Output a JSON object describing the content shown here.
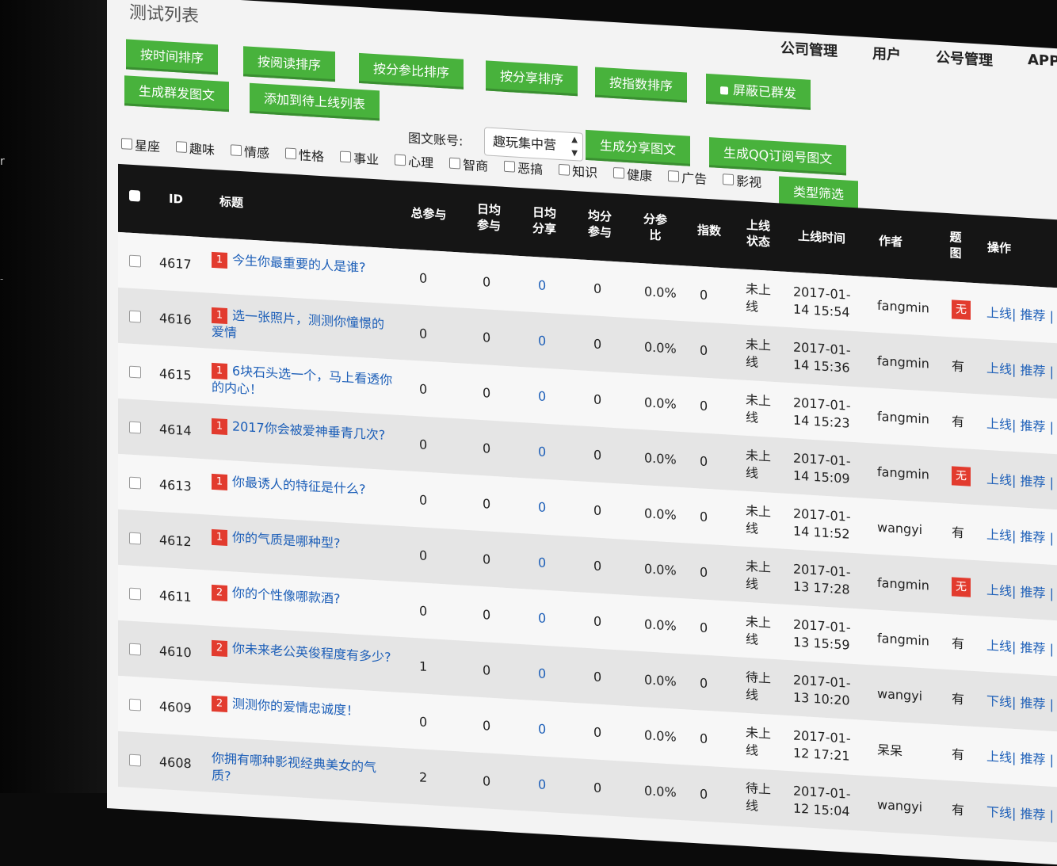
{
  "page_title": "测试列表",
  "nav": [
    "公司管理",
    "用户",
    "公号管理",
    "APP"
  ],
  "sort_buttons": [
    "按时间排序",
    "按阅读排序",
    "按分参比排序",
    "按分享排序",
    "按指数排序",
    "屏蔽已群发"
  ],
  "action_buttons": [
    "生成群发图文",
    "添加到待上线列表",
    "生成分享图文",
    "生成QQ订阅号图文"
  ],
  "account": {
    "label": "图文账号:",
    "selected": "趣玩集中营"
  },
  "filters": [
    "星座",
    "趣味",
    "情感",
    "性格",
    "事业",
    "心理",
    "智商",
    "恶搞",
    "知识",
    "健康",
    "广告",
    "影视"
  ],
  "filter_button": "类型筛选",
  "columns": [
    "ID",
    "标题",
    "总参与",
    "日均参与",
    "日均分享",
    "均分参与",
    "分参比",
    "指数",
    "上线状态",
    "上线时间",
    "作者",
    "题图",
    "操作"
  ],
  "rows": [
    {
      "id": "4617",
      "badge": "1",
      "title": "今生你最重要的人是谁?",
      "total": "0",
      "daily_join": "0",
      "daily_share": "0",
      "avg_join": "0",
      "ratio": "0.0%",
      "index": "0",
      "status": "未上线",
      "time": "2017-01-14 15:54",
      "author": "fangmin",
      "cover": "无",
      "ops": "上线| 推荐 |"
    },
    {
      "id": "4616",
      "badge": "1",
      "title": "选一张照片，测测你憧憬的爱情",
      "total": "0",
      "daily_join": "0",
      "daily_share": "0",
      "avg_join": "0",
      "ratio": "0.0%",
      "index": "0",
      "status": "未上线",
      "time": "2017-01-14 15:36",
      "author": "fangmin",
      "cover": "有",
      "ops": "上线| 推荐 |"
    },
    {
      "id": "4615",
      "badge": "1",
      "title": "6块石头选一个，马上看透你的内心！",
      "total": "0",
      "daily_join": "0",
      "daily_share": "0",
      "avg_join": "0",
      "ratio": "0.0%",
      "index": "0",
      "status": "未上线",
      "time": "2017-01-14 15:23",
      "author": "fangmin",
      "cover": "有",
      "ops": "上线| 推荐 | 编"
    },
    {
      "id": "4614",
      "badge": "1",
      "title": "2017你会被爱神垂青几次?",
      "total": "0",
      "daily_join": "0",
      "daily_share": "0",
      "avg_join": "0",
      "ratio": "0.0%",
      "index": "0",
      "status": "未上线",
      "time": "2017-01-14 15:09",
      "author": "fangmin",
      "cover": "无",
      "ops": "上线| 推荐 | 编"
    },
    {
      "id": "4613",
      "badge": "1",
      "title": "你最诱人的特征是什么?",
      "total": "0",
      "daily_join": "0",
      "daily_share": "0",
      "avg_join": "0",
      "ratio": "0.0%",
      "index": "0",
      "status": "未上线",
      "time": "2017-01-14 11:52",
      "author": "wangyi",
      "cover": "有",
      "ops": "上线| 推荐 | 编"
    },
    {
      "id": "4612",
      "badge": "1",
      "title": "你的气质是哪种型?",
      "total": "0",
      "daily_join": "0",
      "daily_share": "0",
      "avg_join": "0",
      "ratio": "0.0%",
      "index": "0",
      "status": "未上线",
      "time": "2017-01-13 17:28",
      "author": "fangmin",
      "cover": "无",
      "ops": "上线| 推荐 | 编"
    },
    {
      "id": "4611",
      "badge": "2",
      "title": "你的个性像哪款酒?",
      "total": "0",
      "daily_join": "0",
      "daily_share": "0",
      "avg_join": "0",
      "ratio": "0.0%",
      "index": "0",
      "status": "未上线",
      "time": "2017-01-13 15:59",
      "author": "fangmin",
      "cover": "有",
      "ops": "上线| 推荐 | 编"
    },
    {
      "id": "4610",
      "badge": "2",
      "title": "你未来老公英俊程度有多少?",
      "total": "1",
      "daily_join": "0",
      "daily_share": "0",
      "avg_join": "0",
      "ratio": "0.0%",
      "index": "0",
      "status": "待上线",
      "time": "2017-01-13 10:20",
      "author": "wangyi",
      "cover": "有",
      "ops": "下线| 推荐 | 编辑"
    },
    {
      "id": "4609",
      "badge": "2",
      "title": "测测你的爱情忠诚度！",
      "total": "0",
      "daily_join": "0",
      "daily_share": "0",
      "avg_join": "0",
      "ratio": "0.0%",
      "index": "0",
      "status": "未上线",
      "time": "2017-01-12 17:21",
      "author": "呆呆",
      "cover": "有",
      "ops": "上线| 推荐 | 编辑"
    },
    {
      "id": "4608",
      "badge": "",
      "title": "你拥有哪种影视经典美女的气质?",
      "total": "2",
      "daily_join": "0",
      "daily_share": "0",
      "avg_join": "0",
      "ratio": "0.0%",
      "index": "0",
      "status": "待上线",
      "time": "2017-01-12 15:04",
      "author": "wangyi",
      "cover": "有",
      "ops": "下线| 推荐 | 编辑"
    }
  ]
}
